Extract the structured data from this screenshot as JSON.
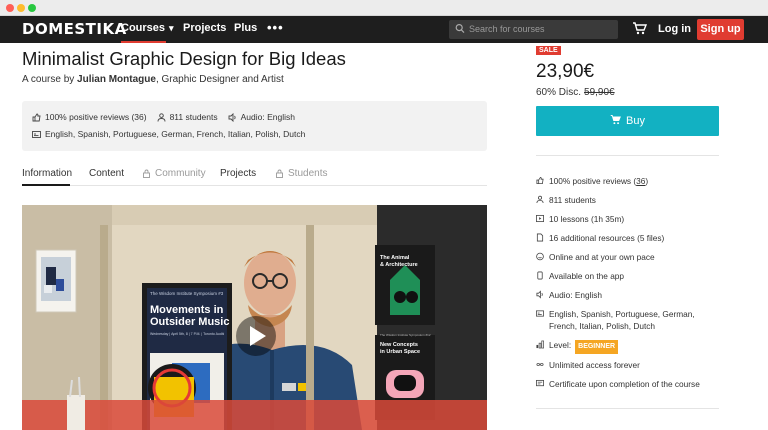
{
  "nav": {
    "logo": "DOMESTIKA",
    "courses": "Courses",
    "projects": "Projects",
    "plus": "Plus",
    "more": "•••",
    "search_placeholder": "Search for courses",
    "login": "Log in",
    "signup": "Sign up"
  },
  "course": {
    "title": "Minimalist Graphic Design for Big Ideas",
    "byline_prefix": "A course by ",
    "author": "Julian Montague",
    "byline_suffix": ", Graphic Designer and Artist"
  },
  "infobox": {
    "reviews": "100% positive reviews (36)",
    "students": "811 students",
    "audio": "Audio: English",
    "subtitles": "English, Spanish, Portuguese, German, French, Italian, Polish, Dutch"
  },
  "tabs": {
    "information": "Information",
    "content": "Content",
    "community": "Community",
    "projects": "Projects",
    "students": "Students"
  },
  "video": {
    "poster_small": "The Wisdom Institute Symposium #3",
    "poster_title_line1": "Movements in",
    "poster_title_line2": "Outsider Music",
    "poster_meta": "Wednesday | April 5th, 8 | 7 P.M. | Toronto Auditorium",
    "card1_line1": "The Animal",
    "card1_line2": "& Architecture",
    "card2_small": "The Wisdom Institute Symposium #12",
    "card2_line1": "New Concepts",
    "card2_line2": "in Urban Space"
  },
  "purchase": {
    "sale_badge": "SALE",
    "price": "23,90€",
    "discount_label": "60% Disc.",
    "old_price": "59,90€",
    "buy_label": "Buy"
  },
  "features": {
    "reviews_prefix": "100% positive reviews (",
    "reviews_count": "36",
    "reviews_suffix": ")",
    "students": "811 students",
    "lessons": "10 lessons (1h 35m)",
    "resources": "16 additional resources (5 files)",
    "online": "Online and at your own pace",
    "app": "Available on the app",
    "audio": "Audio: English",
    "subtitles": "English, Spanish, Portuguese, German, French, Italian, Polish, Dutch",
    "level_label": "Level:",
    "level_badge": "BEGINNER",
    "access": "Unlimited access forever",
    "certificate": "Certificate upon completion of the course"
  }
}
